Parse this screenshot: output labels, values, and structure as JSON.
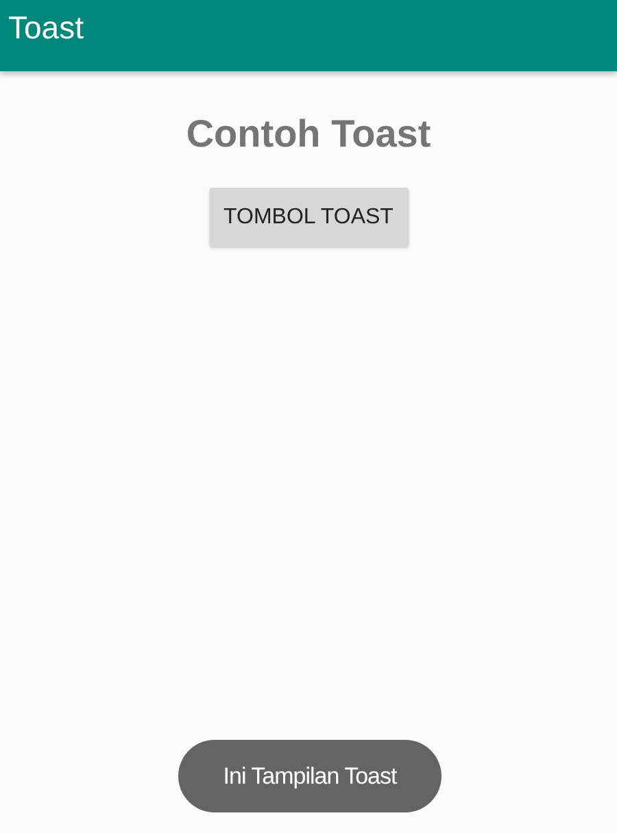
{
  "app_bar": {
    "title": "Toast"
  },
  "heading": "Contoh Toast",
  "button": {
    "label": "TOMBOL TOAST"
  },
  "toast": {
    "message": "Ini Tampilan Toast"
  }
}
